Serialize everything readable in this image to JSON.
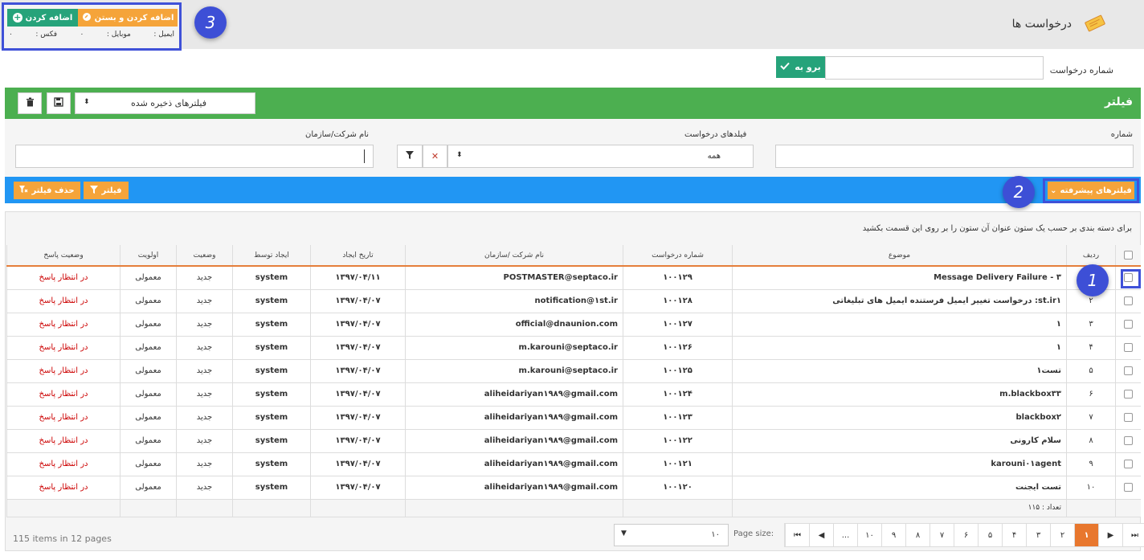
{
  "header": {
    "title": "درخواست ها",
    "icon": "ticket-icon"
  },
  "add_box": {
    "add_label": "اضافه کردن",
    "add_close_label": "اضافه کردن و بستن",
    "email_label": "ایمیل :",
    "mobile_label": "موبایل :",
    "mobile_value": "۰",
    "fax_label": "فکس :",
    "fax_value": "۰"
  },
  "markers": {
    "m1": "1",
    "m2": "2",
    "m3": "3"
  },
  "request_search": {
    "label": "شماره درخواست",
    "value": "",
    "go_label": "برو به"
  },
  "filter": {
    "title": "فیلتر",
    "saved_filters": "فیلترهای ذخیره شده",
    "number_label": "شماره",
    "fields_label": "فیلدهای درخواست",
    "fields_value": "همه",
    "company_label": "نام شرکت/سازمان",
    "advanced_label": "فیلترهای پیشرفته",
    "filter_button": "فیلتر",
    "remove_filter_button": "حذف فیلتر"
  },
  "grid": {
    "group_hint": "برای دسته بندی بر حسب یک ستون عنوان آن ستون را بر روی این قسمت بکشید",
    "columns": {
      "row": "ردیف",
      "subject": "موضوع",
      "reqno": "شماره درخواست",
      "company": "نام شرکت /سازمان",
      "created": "تاریخ ایجاد",
      "created_by": "ایجاد توسط",
      "status": "وضعیت",
      "priority": "اولویت",
      "reply_status": "وضعیت پاسخ"
    },
    "rows": [
      {
        "row": "۱",
        "subject": "Message Delivery Failure - ۳",
        "reqno": "۱۰۰۱۲۹",
        "company": "POSTMASTER@septaco.ir",
        "created": "۱۳۹۷/۰۴/۱۱",
        "by": "system",
        "status": "جدید",
        "priority": "معمولی",
        "reply": "در انتظار پاسخ"
      },
      {
        "row": "۲",
        "subject": "st.ir۱: درخواست تغییر ایمیل فرستنده ایمیل های تبلیغاتی",
        "reqno": "۱۰۰۱۲۸",
        "company": "notification@۱st.ir",
        "created": "۱۳۹۷/۰۴/۰۷",
        "by": "system",
        "status": "جدید",
        "priority": "معمولی",
        "reply": "در انتظار پاسخ"
      },
      {
        "row": "۳",
        "subject": "۱",
        "reqno": "۱۰۰۱۲۷",
        "company": "official@dnaunion.com",
        "created": "۱۳۹۷/۰۴/۰۷",
        "by": "system",
        "status": "جدید",
        "priority": "معمولی",
        "reply": "در انتظار پاسخ"
      },
      {
        "row": "۴",
        "subject": "۱",
        "reqno": "۱۰۰۱۲۶",
        "company": "m.karouni@septaco.ir",
        "created": "۱۳۹۷/۰۴/۰۷",
        "by": "system",
        "status": "جدید",
        "priority": "معمولی",
        "reply": "در انتظار پاسخ"
      },
      {
        "row": "۵",
        "subject": "تست۱",
        "reqno": "۱۰۰۱۲۵",
        "company": "m.karouni@septaco.ir",
        "created": "۱۳۹۷/۰۴/۰۷",
        "by": "system",
        "status": "جدید",
        "priority": "معمولی",
        "reply": "در انتظار پاسخ"
      },
      {
        "row": "۶",
        "subject": "m.blackbox۳۳",
        "reqno": "۱۰۰۱۲۴",
        "company": "aliheidariyan۱۹۸۹@gmail.com",
        "created": "۱۳۹۷/۰۴/۰۷",
        "by": "system",
        "status": "جدید",
        "priority": "معمولی",
        "reply": "در انتظار پاسخ"
      },
      {
        "row": "۷",
        "subject": "blackbox۲",
        "reqno": "۱۰۰۱۲۳",
        "company": "aliheidariyan۱۹۸۹@gmail.com",
        "created": "۱۳۹۷/۰۴/۰۷",
        "by": "system",
        "status": "جدید",
        "priority": "معمولی",
        "reply": "در انتظار پاسخ"
      },
      {
        "row": "۸",
        "subject": "سلام کارونی",
        "reqno": "۱۰۰۱۲۲",
        "company": "aliheidariyan۱۹۸۹@gmail.com",
        "created": "۱۳۹۷/۰۴/۰۷",
        "by": "system",
        "status": "جدید",
        "priority": "معمولی",
        "reply": "در انتظار پاسخ"
      },
      {
        "row": "۹",
        "subject": "karouni۰۱agent",
        "reqno": "۱۰۰۱۲۱",
        "company": "aliheidariyan۱۹۸۹@gmail.com",
        "created": "۱۳۹۷/۰۴/۰۷",
        "by": "system",
        "status": "جدید",
        "priority": "معمولی",
        "reply": "در انتظار پاسخ"
      },
      {
        "row": "۱۰",
        "subject": "تست ایجنت",
        "reqno": "۱۰۰۱۲۰",
        "company": "aliheidariyan۱۹۸۹@gmail.com",
        "created": "۱۳۹۷/۰۴/۰۷",
        "by": "system",
        "status": "جدید",
        "priority": "معمولی",
        "reply": "در انتظار پاسخ"
      }
    ],
    "count_label": "تعداد : ۱۱۵"
  },
  "pager": {
    "pages": [
      "۱",
      "۲",
      "۳",
      "۴",
      "۵",
      "۶",
      "۷",
      "۸",
      "۹",
      "۱۰",
      "..."
    ],
    "active": "۱",
    "page_size_label": "Page size:",
    "page_size_value": "۱۰",
    "items_info": "115 items in 12 pages"
  },
  "colors": {
    "green": "#4caf50",
    "blue": "#2196f3",
    "orange": "#f5a43a",
    "teal": "#26a37a",
    "marker": "#3d4fd6"
  }
}
